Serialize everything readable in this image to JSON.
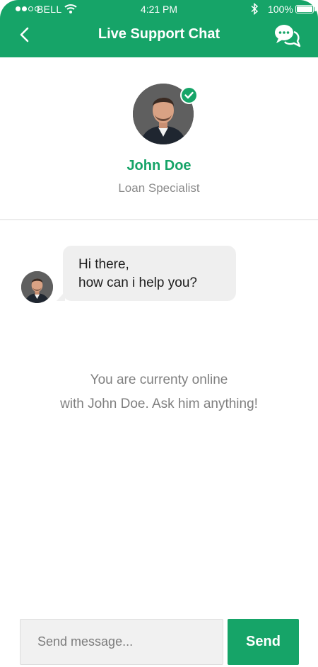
{
  "status_bar": {
    "carrier": "BELL",
    "time": "4:21 PM",
    "battery": "100%",
    "icons": [
      "signal-dots-icon",
      "wifi-icon",
      "bluetooth-icon",
      "battery-icon"
    ]
  },
  "header": {
    "title": "Live Support Chat",
    "back_icon": "chevron-left-icon",
    "chat_icon": "chat-bubbles-icon"
  },
  "agent": {
    "name": "John Doe",
    "role": "Loan Specialist",
    "verified_icon": "check-badge-icon"
  },
  "messages": [
    {
      "sender": "agent",
      "lines": [
        "Hi there,",
        "how can i help you?"
      ]
    }
  ],
  "notice": {
    "line1": "You are currenty online",
    "line2": "with John Doe. Ask him anything!"
  },
  "composer": {
    "placeholder": "Send message...",
    "value": "",
    "send_label": "Send"
  },
  "colors": {
    "brand": "#16a468",
    "bubble": "#efefef",
    "muted_text": "#7f7f7f"
  }
}
